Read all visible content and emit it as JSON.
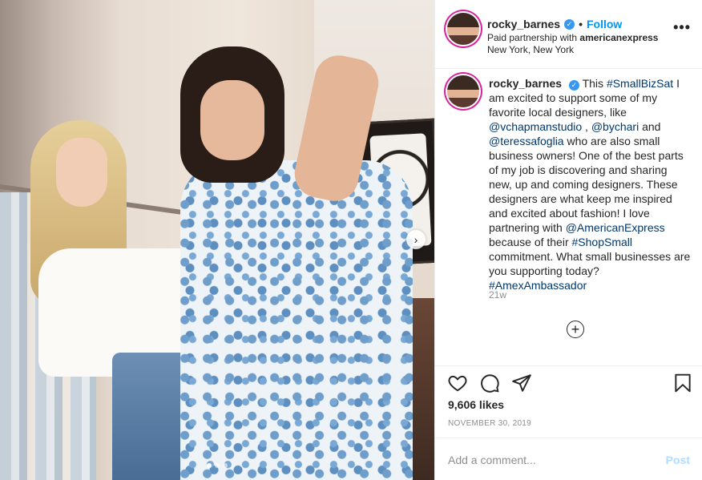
{
  "post": {
    "username": "rocky_barnes",
    "follow_label": "Follow",
    "separator": "•",
    "partnership_prefix": "Paid partnership with",
    "partner": "americanexpress",
    "location": "New York, New York",
    "more_label": "•••",
    "carousel": {
      "dots": 3,
      "active": 0
    }
  },
  "caption": {
    "username": "rocky_barnes",
    "segments": [
      {
        "text": "This ",
        "link": false
      },
      {
        "text": "#SmallBizSat",
        "link": true
      },
      {
        "text": " I am excited to support some of my favorite local designers, like ",
        "link": false
      },
      {
        "text": "@vchapmanstudio",
        "link": true
      },
      {
        "text": " , ",
        "link": false
      },
      {
        "text": "@bychari",
        "link": true
      },
      {
        "text": " and ",
        "link": false
      },
      {
        "text": "@teressafoglia",
        "link": true
      },
      {
        "text": " who are also small business owners! One of the best parts of my job is discovering and sharing new, up and coming designers. These designers are what keep me inspired and excited about fashion! I love partnering with ",
        "link": false
      },
      {
        "text": "@AmericanExpress",
        "link": true
      },
      {
        "text": " because of their ",
        "link": false
      },
      {
        "text": "#ShopSmall",
        "link": true
      },
      {
        "text": " commitment. What small businesses are you supporting today? ",
        "link": false
      },
      {
        "text": "#AmexAmbassador",
        "link": true
      }
    ],
    "age": "21w",
    "load_more_symbol": "+"
  },
  "stats": {
    "likes": "9,606 likes",
    "date": "NOVEMBER 30, 2019"
  },
  "comment": {
    "placeholder": "Add a comment...",
    "post_label": "Post"
  },
  "icons": {
    "like": "heart-icon",
    "comment": "comment-icon",
    "share": "paper-plane-icon",
    "save": "bookmark-icon",
    "next": "chevron-right-icon",
    "verified": "verified-badge-icon"
  },
  "colors": {
    "accent": "#0095f6",
    "link": "#00376b",
    "muted": "#8e8e8e",
    "post_disabled": "#b3dbff"
  }
}
